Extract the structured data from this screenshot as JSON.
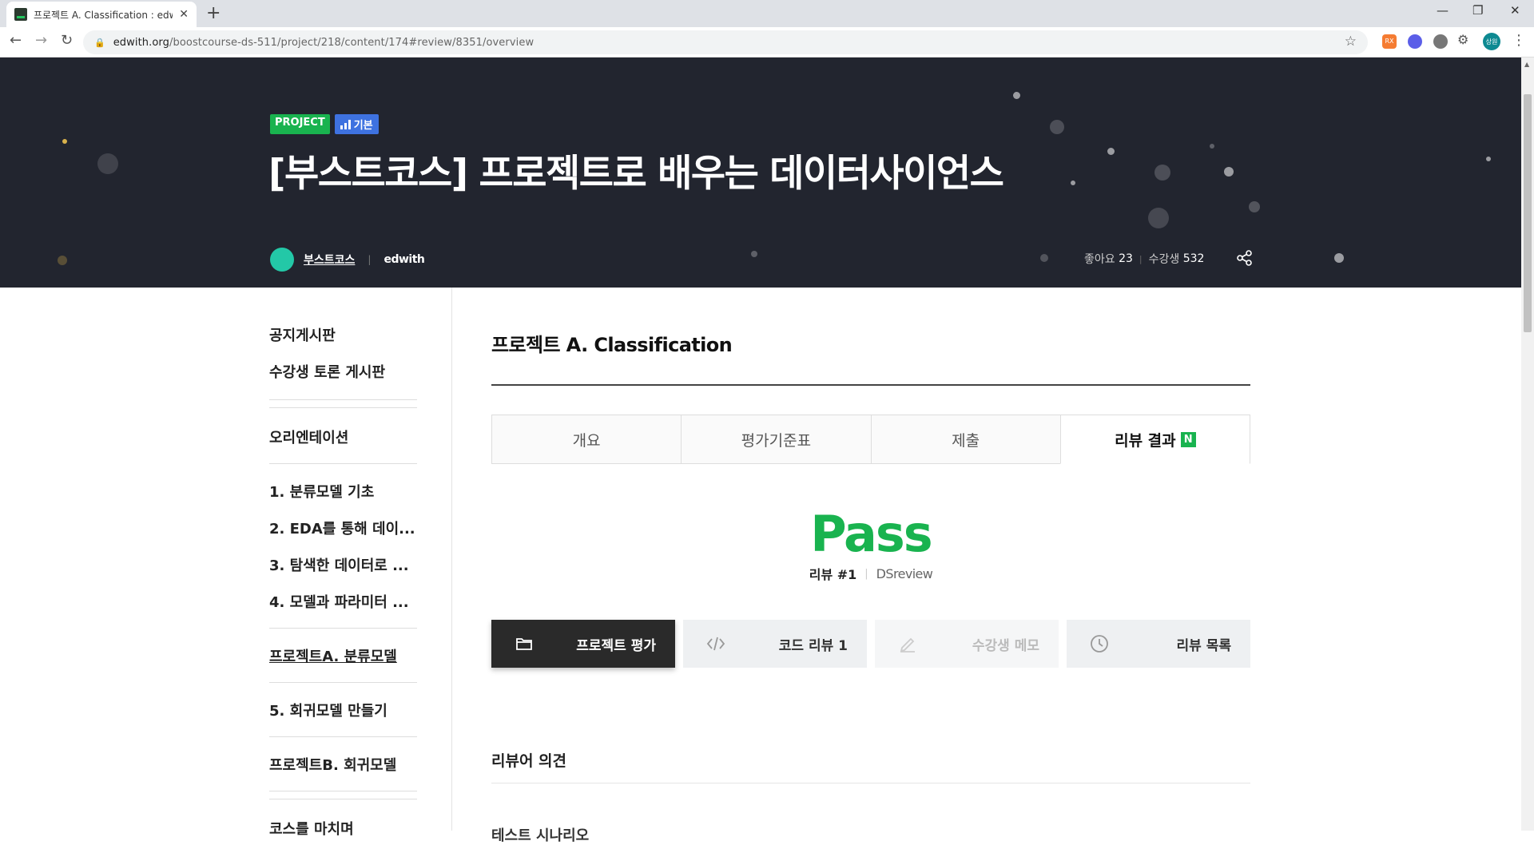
{
  "browser": {
    "tab_title": "프로젝트 A. Classification : edwith",
    "tab_close": "✕",
    "new_tab": "+",
    "url_host": "edwith.org",
    "url_path": "/boostcourse-ds-511/project/218/content/174#review/8351/overview",
    "profile_initials": "상원",
    "extension_label": "RX"
  },
  "hero": {
    "badge_project": "PROJECT",
    "badge_level": "기본",
    "title": "[부스트코스] 프로젝트로 배우는 데이터사이언스",
    "org_name": "부스트코스",
    "org_separator": "|",
    "brand": "edwith",
    "likes_label": "좋아요",
    "likes_count": "23",
    "stats_separator": "|",
    "students_label": "수강생",
    "students_count": "532"
  },
  "sidebar": {
    "items": [
      "공지게시판",
      "수강생 토론 게시판",
      "오리엔테이션",
      "1. 분류모델 기초",
      "2. EDA를 통해 데이...",
      "3. 탐색한 데이터로 ...",
      "4. 모델과 파라미터 ...",
      "프로젝트A. 분류모델",
      "5. 회귀모델 만들기",
      "프로젝트B. 회귀모델",
      "코스를 마치며"
    ]
  },
  "main": {
    "title": "프로젝트 A. Classification",
    "tabs": [
      "개요",
      "평가기준표",
      "제출",
      "리뷰 결과"
    ],
    "new_badge": "N",
    "result": "Pass",
    "review_number": "리뷰 #1",
    "review_separator": "|",
    "reviewer": "DSreview",
    "actions": [
      "프로젝트 평가",
      "코드 리뷰 1",
      "수강생 메모",
      "리뷰 목록"
    ],
    "opinion_title": "리뷰어 의견",
    "opinion_next": "테스트 시나리오"
  }
}
